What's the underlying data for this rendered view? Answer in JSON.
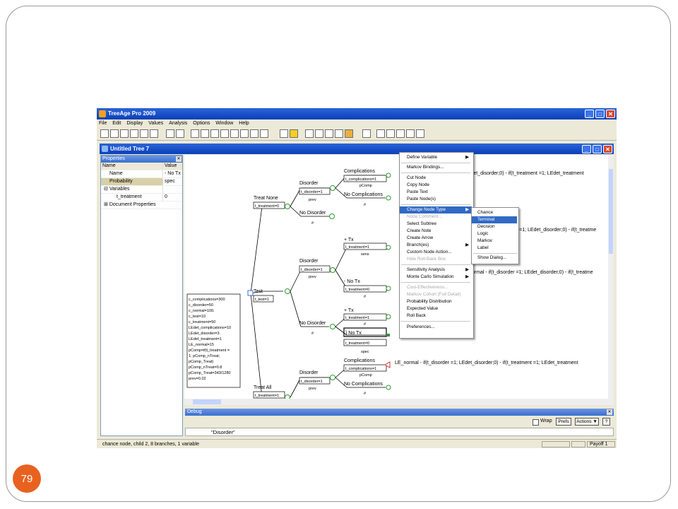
{
  "slide": {
    "page_number": "79"
  },
  "app": {
    "title": "TreeAge Pro 2009",
    "menu": [
      "File",
      "Edit",
      "Display",
      "Values",
      "Analysis",
      "Options",
      "Window",
      "Help"
    ],
    "document_title": "Untitled Tree 7"
  },
  "properties": {
    "title": "Properties",
    "col_name": "Name",
    "col_value": "Value",
    "rows": [
      {
        "name": "Name",
        "value": "- No Tx"
      },
      {
        "name": "Probability",
        "value": "spec"
      },
      {
        "name": "Variables",
        "value": ""
      },
      {
        "name": "t_treatment",
        "value": "0"
      },
      {
        "name": "Document Properties",
        "value": ""
      }
    ]
  },
  "tree": {
    "root_definitions": [
      "c_complications=300",
      "c_disorder=50",
      "c_normal=100.",
      "c_test=10",
      "c_treatment=50",
      "LEdet_complications=10",
      "LEdet_disorder=3.",
      "LEdet_treatment=1",
      "LE_normal=15",
      "pComp=if(t_treatment =",
      "1; pComp_nTreat;",
      "pComp_Treat)",
      "pComp_nTreat=0.8",
      "pComp_Treat=343/1280",
      "prev=0.02"
    ],
    "treat_none": {
      "label": "Treat None",
      "def": "t_treatment=0"
    },
    "test": {
      "label": "Test",
      "def": "t_test=1"
    },
    "treat_all": {
      "label": "Treat All",
      "def": "t_treatment=1"
    },
    "disorder": "Disorder",
    "disorder_def": "t_disorder=1",
    "no_disorder": "No Disorder",
    "prev": "prev",
    "hash": "#",
    "complications": "Complications",
    "complications_def": "t_complications=1",
    "no_complications": "No Complications",
    "pcomp": "pComp",
    "plus_tx": "+ Tx",
    "minus_tx": "- No Tx",
    "treatment_def1": "t_treatment=1",
    "treatment_def0": "t_treatment=0",
    "sens": "sens",
    "spec": "spec",
    "no_tx_selected": "} No Tx",
    "payoff_1": "; LEdet_disorder;0) - if(t_treatment =1; LEdet_treatment",
    "payoff_2": "er =1; LEdet_disorder;0) - if(t_treatme",
    "payoff_3": "normal - if(t_disorder =1; LEdet_disorder;0) - if(t_treatme",
    "payoff_4": "LE_normal - if(t_disorder =1; LEdet_disorder;0) - if(t_treatment =1; LEdet_treatment"
  },
  "context_menu": [
    {
      "label": "Define Variable",
      "arrow": "▶",
      "disabled": false
    },
    {
      "label": "Markov Bindings...",
      "disabled": false
    },
    {
      "label": "Cut Node",
      "disabled": false
    },
    {
      "label": "Copy Node",
      "disabled": false
    },
    {
      "label": "Paste Text",
      "disabled": false
    },
    {
      "label": "Paste Node(s)",
      "disabled": false
    },
    {
      "label": "Change Node Type",
      "arrow": "▶",
      "disabled": false
    },
    {
      "label": "Node Comment...",
      "disabled": true
    },
    {
      "label": "Select Subtree",
      "disabled": false
    },
    {
      "label": "Create Note",
      "disabled": false
    },
    {
      "label": "Create Arrow",
      "disabled": false
    },
    {
      "label": "Branch(es)",
      "arrow": "▶",
      "disabled": false
    },
    {
      "label": "Custom Node Action...",
      "disabled": false
    },
    {
      "label": "Hide Roll-Back Box",
      "disabled": true
    },
    {
      "label": "Sensitivity Analysis",
      "arrow": "▶",
      "disabled": false
    },
    {
      "label": "Monte Carlo Simulation",
      "arrow": "▶",
      "disabled": false
    },
    {
      "label": "Cost-Effectiveness...",
      "disabled": true
    },
    {
      "label": "Markov Cohort (Full Detail)",
      "disabled": true
    },
    {
      "label": "Probability Distribution",
      "disabled": false
    },
    {
      "label": "Expected Value",
      "disabled": false
    },
    {
      "label": "Roll Back",
      "disabled": false
    },
    {
      "label": "Preferences...",
      "disabled": false
    }
  ],
  "submenu": [
    "Chance",
    "Terminal",
    "Decision",
    "Logic",
    "Markov",
    "Label",
    "Show Dialog..."
  ],
  "debug": {
    "title": "Debug",
    "wrap": "Wrap",
    "prefs": "Prefs",
    "actions": "Actions ▼",
    "help": "?",
    "value": "\"Disorder\""
  },
  "status": {
    "left": "chance node, child 2, 8 branches, 1 variable",
    "right": "Payoff 1"
  },
  "colors": {
    "title_blue": "#0a3fb8",
    "highlight": "#316ac5",
    "badge": "#e8621f",
    "node_green": "#2e9a2e",
    "terminal_red": "#d03030"
  }
}
